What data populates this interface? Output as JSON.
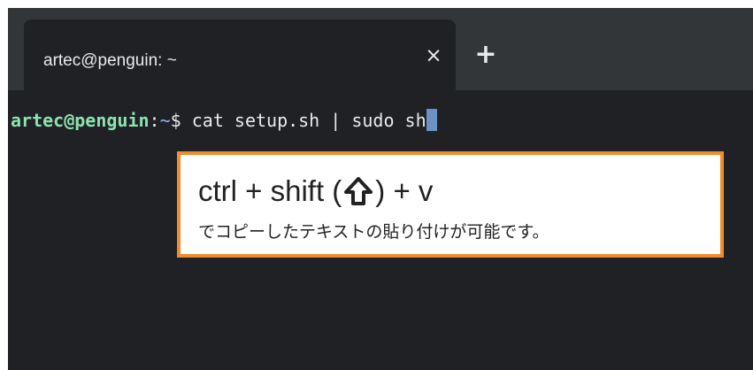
{
  "tab": {
    "title": "artec@penguin: ~",
    "close_glyph": "×",
    "close_icon": "close-icon",
    "new_tab_glyph": "+",
    "new_tab_icon": "plus-icon"
  },
  "terminal": {
    "user_host": "artec@penguin",
    "colon": ":",
    "path": "~",
    "dollar": "$ ",
    "command": "cat setup.sh | sudo sh"
  },
  "callout": {
    "shortcut_prefix": "ctrl + shift (",
    "shortcut_suffix": ") + v",
    "shift_icon": "shift-arrow-icon",
    "description": "でコピーしたテキストの貼り付けが可能です。"
  },
  "colors": {
    "tabstrip": "#323639",
    "terminal_bg": "#202124",
    "prompt_user": "#8ce3b0",
    "prompt_path": "#8ab4f8",
    "callout_border": "#f08c2e",
    "cursor": "#7aa4e0"
  }
}
